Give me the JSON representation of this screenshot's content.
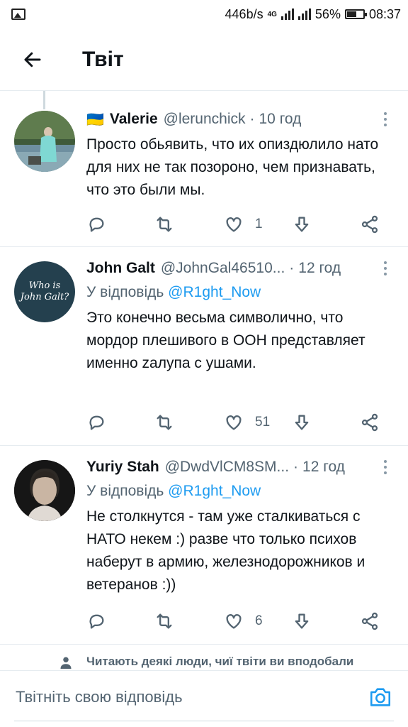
{
  "status_bar": {
    "speed": "446b/s",
    "network": "4G",
    "battery": "56%",
    "time": "08:37",
    "icons": [
      "gallery-icon",
      "signal-icon",
      "battery-icon"
    ]
  },
  "header": {
    "title": "Твіт",
    "back_icon": "arrow-left-icon"
  },
  "tweets": [
    {
      "flag": "🇺🇦",
      "name": "Valerie",
      "handle": "@lerunchick",
      "separator": "·",
      "time": "10 год",
      "reply_prefix": "",
      "reply_to": "",
      "text": "Просто обьявить, что их опиздюлило нато для них не так позороно, чем признавать, что это были мы.",
      "likes": "1"
    },
    {
      "name": "John Galt",
      "handle": "@JohnGal46510...",
      "separator": "·",
      "time": "12 год",
      "reply_prefix": "У відповідь",
      "reply_to": "@R1ght_Now",
      "text": "Это конечно весьма символично, что мордор плешивого в ООН представляет именно zалупа с ушами.",
      "likes": "51",
      "avatar_text_1": "Who is",
      "avatar_text_2": "John Galt?"
    },
    {
      "name": "Yuriy Stah",
      "handle": "@DwdVlCM8SM...",
      "separator": "·",
      "time": "12 год",
      "reply_prefix": "У відповідь",
      "reply_to": "@R1ght_Now",
      "text": "Не столкнутся  - там уже сталкиваться с НАТО некем :) разве что только психов наберут в армию, железнодорожников и ветеранов :))",
      "likes": "6"
    }
  ],
  "notice": {
    "text": "Читають деякі люди, чиї твіти ви вподобали"
  },
  "composer": {
    "placeholder": "Твітніть свою відповідь",
    "camera_icon": "camera-icon"
  },
  "colors": {
    "accent": "#1d9bf0",
    "secondary_text": "#536471",
    "divider": "#e6ecf0"
  }
}
